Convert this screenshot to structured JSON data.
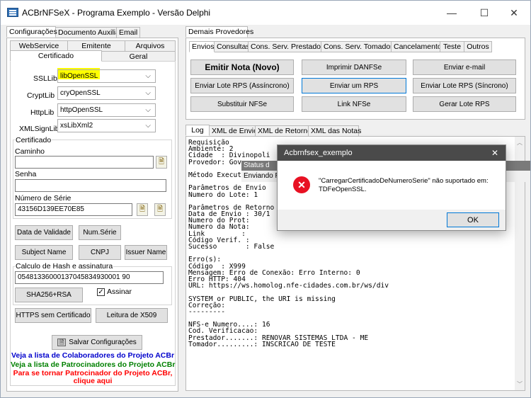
{
  "window": {
    "title": "ACBrNFSeX - Programa Exemplo - Versão Delphi",
    "minimize": "—",
    "maximize": "☐",
    "close": "✕"
  },
  "left_tabs": {
    "row1": [
      "Configurações",
      "Documento Auxiliar",
      "Email"
    ],
    "row2": [
      "WebService",
      "Emitente",
      "Arquivos"
    ],
    "row3": [
      "Certificado",
      "Geral"
    ]
  },
  "libs": [
    {
      "label": "SSLLib",
      "value": "libOpenSSL"
    },
    {
      "label": "CryptLib",
      "value": "cryOpenSSL"
    },
    {
      "label": "HttpLib",
      "value": "httpOpenSSL"
    },
    {
      "label": "XMLSignLib",
      "value": "xsLibXml2"
    }
  ],
  "certificado": {
    "group_title": "Certificado",
    "caminho_label": "Caminho",
    "caminho_value": "",
    "senha_label": "Senha",
    "senha_value": "",
    "serie_label": "Número de Série",
    "serie_value": "43156D139EE70E85"
  },
  "cert_buttons": [
    "Data de Validade",
    "Num.Série",
    "Subject Name",
    "CNPJ",
    "Issuer Name"
  ],
  "hash": {
    "group_title": "Calculo de Hash e assinatura",
    "value": "05481336000137045834930001 90",
    "sha_button": "SHA256+RSA",
    "assinar_label": "Assinar",
    "assinar_checked": "✓"
  },
  "bottom_buttons": [
    "HTTPS sem Certificado",
    "Leitura de X509"
  ],
  "salvar_button": "Salvar Configurações",
  "links": [
    {
      "text": "Veja a lista de Colaboradores do Projeto ACBr",
      "color": "#0000cc"
    },
    {
      "text": "Veja a lista de Patrocinadores do Projeto ACBr",
      "color": "#008000"
    },
    {
      "text": "Para se tornar Patrocinador do Projeto ACBr,",
      "color": "#ff0000"
    },
    {
      "text": "clique aqui",
      "color": "#ff0000"
    }
  ],
  "right_tabs": {
    "top": [
      "Demais Provedores"
    ],
    "main": [
      "Envios",
      "Consultas",
      "Cons. Serv. Prestados",
      "Cons. Serv. Tomados",
      "Cancelamento",
      "Teste",
      "Outros"
    ],
    "log": [
      "Log",
      "XML de Envio",
      "XML de Retorno",
      "XML das Notas"
    ]
  },
  "action_buttons": [
    [
      "Emitir Nota (Novo)",
      "Imprimir DANFSe",
      "Enviar e-mail"
    ],
    [
      "Enviar Lote RPS (Assíncrono)",
      "Enviar um RPS",
      "Enviar Lote RPS (Síncrono)"
    ],
    [
      "Substituir NFSe",
      "Link NFSe",
      "Gerar Lote RPS"
    ]
  ],
  "log_lines": [
    "Requisição",
    "Ambiente: 2",
    "Cidade  : Divinopoli",
    "Provedor: Gov",
    "",
    "Método Execut",
    "",
    "Parâmetros de Envio",
    "Numero do Lote: 1",
    "",
    "Parâmetros de Retorno",
    "Data de Envio : 30/1",
    "Numero do Prot:",
    "Numero da Nota:",
    "Link         :",
    "Código Verif. :",
    "Sucesso       : False",
    "",
    "Erro(s):",
    "Código  : X999",
    "Mensagem: Erro de Conexão: Erro Interno: 0",
    "Erro HTTP: 404",
    "URL: https://ws.homolog.nfe-cidades.com.br/ws/div",
    "",
    "SYSTEM or PUBLIC, the URI is missing",
    "Correção:",
    "---------",
    "",
    "NFS-e Numero....: 16",
    "Cod. Verificacao:",
    "Prestador.......: RENOVAR SISTEMAS LTDA - ME",
    "Tomador.........: INSCRICAO DE TESTE"
  ],
  "status_overlay": {
    "title": "Status d",
    "text": "Enviando R"
  },
  "dialog": {
    "title": "Acbrnfsex_exemplo",
    "close": "✕",
    "message_line1": "\"CarregarCertificadoDeNumeroSerie\" não suportado em:",
    "message_line2": "TDFeOpenSSL.",
    "ok_label": "OK",
    "error_icon": "✕"
  },
  "colors": {
    "highlight": "#ffff00",
    "accent": "#0078d7",
    "error": "#e81123"
  }
}
